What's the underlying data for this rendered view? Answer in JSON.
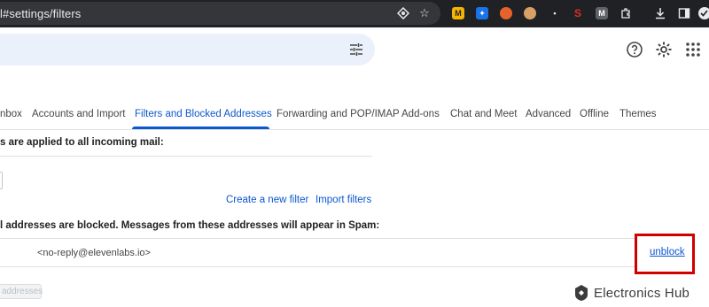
{
  "browser": {
    "url": "l#settings/filters",
    "extensions": [
      {
        "name": "m-extension",
        "label": "M",
        "color": "#f4b400"
      },
      {
        "name": "dropbox-extension",
        "label": "",
        "color": "#1a73e8"
      },
      {
        "name": "orange-extension",
        "label": "",
        "color": "#e8622c"
      },
      {
        "name": "face-extension",
        "label": "",
        "color": "#d9a066"
      },
      {
        "name": "pin-extension",
        "label": "",
        "color": "#e8eaed"
      },
      {
        "name": "s-extension",
        "label": "S",
        "color": "#d93025"
      },
      {
        "name": "gmail-m-extension",
        "label": "M",
        "color": "#5f6368"
      }
    ]
  },
  "tabs": [
    {
      "label": "nbox"
    },
    {
      "label": "Accounts and Import"
    },
    {
      "label": "Filters and Blocked Addresses",
      "active": true
    },
    {
      "label": "Forwarding and POP/IMAP"
    },
    {
      "label": "Add-ons"
    },
    {
      "label": "Chat and Meet"
    },
    {
      "label": "Advanced"
    },
    {
      "label": "Offline"
    },
    {
      "label": "Themes"
    }
  ],
  "filters": {
    "heading": "s are applied to all incoming mail:",
    "create_link": "Create a new filter",
    "import_link": "Import filters"
  },
  "blocked": {
    "heading": "l addresses are blocked. Messages from these addresses will appear in Spam:",
    "address": "<no-reply@elevenlabs.io>",
    "unblock_label": "unblock",
    "delete_button": "addresses"
  },
  "watermark": {
    "text": "Electronics Hub"
  },
  "colors": {
    "accent": "#0b57d0",
    "highlight": "#d00000",
    "chrome_bg": "#202124"
  }
}
